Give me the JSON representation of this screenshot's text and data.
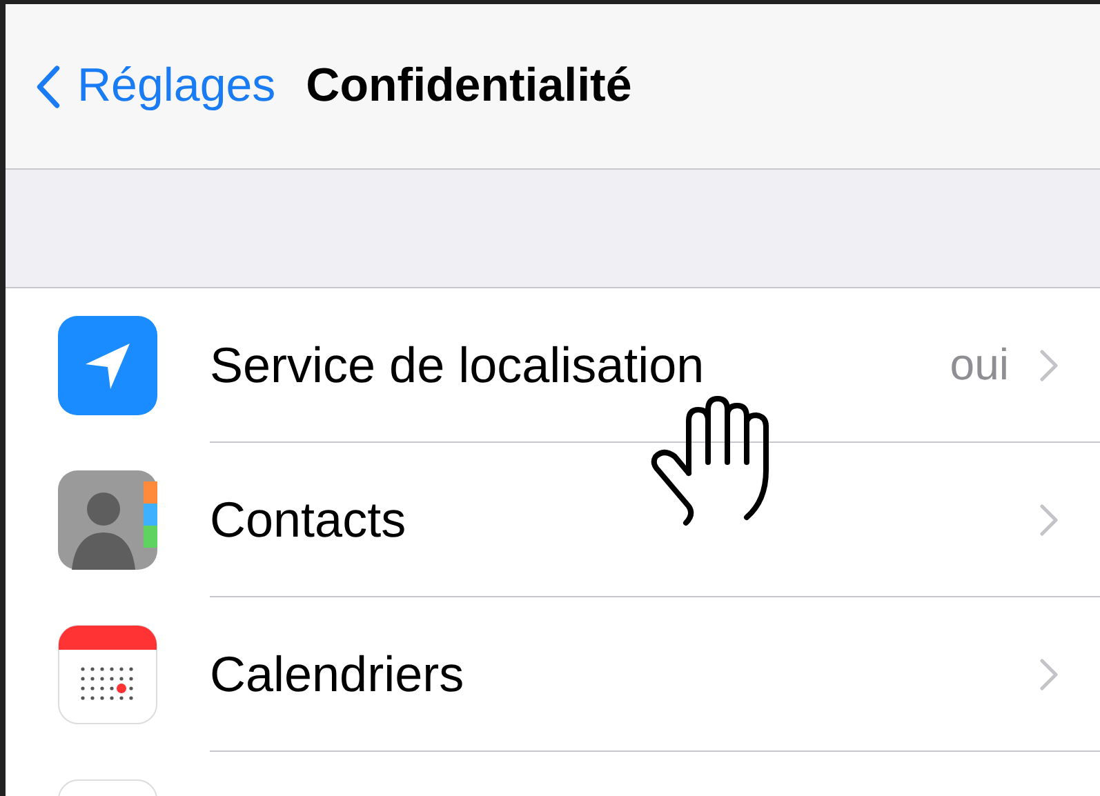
{
  "nav": {
    "back_label": "Réglages",
    "title": "Confidentialité"
  },
  "rows": [
    {
      "kind": "location",
      "label": "Service de localisation",
      "value": "oui"
    },
    {
      "kind": "contacts",
      "label": "Contacts"
    },
    {
      "kind": "calendar",
      "label": "Calendriers"
    },
    {
      "kind": "reminders"
    }
  ]
}
